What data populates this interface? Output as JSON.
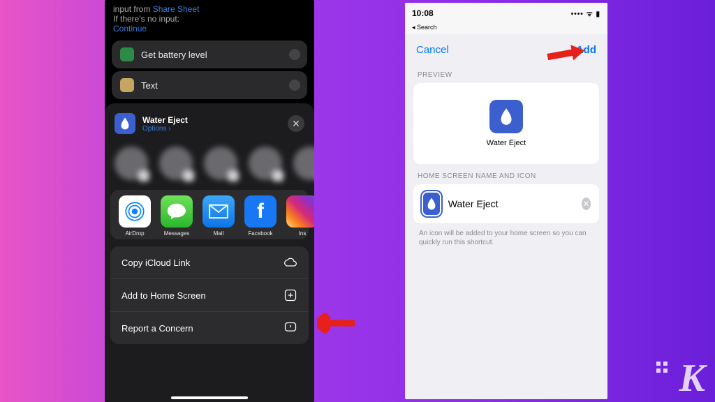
{
  "left": {
    "header": {
      "input_from": "input from",
      "share_sheet": "Share Sheet",
      "no_input": "If there's no input:",
      "continue": "Continue"
    },
    "blocks": {
      "battery": "Get battery level",
      "text": "Text"
    },
    "share": {
      "title": "Water Eject",
      "options": "Options ›",
      "apps": {
        "airdrop": "AirDrop",
        "messages": "Messages",
        "mail": "Mail",
        "facebook": "Facebook",
        "instagram": "Ins"
      },
      "actions": {
        "copy": "Copy iCloud Link",
        "add_home": "Add to Home Screen",
        "report": "Report a Concern"
      }
    }
  },
  "right": {
    "time": "10:08",
    "back": "◂ Search",
    "cancel": "Cancel",
    "add": "Add",
    "preview_header": "PREVIEW",
    "preview_name": "Water Eject",
    "section_header": "HOME SCREEN NAME AND ICON",
    "input_value": "Water Eject",
    "footer": "An icon will be added to your home screen so you can quickly run this shortcut."
  },
  "logo": "K"
}
